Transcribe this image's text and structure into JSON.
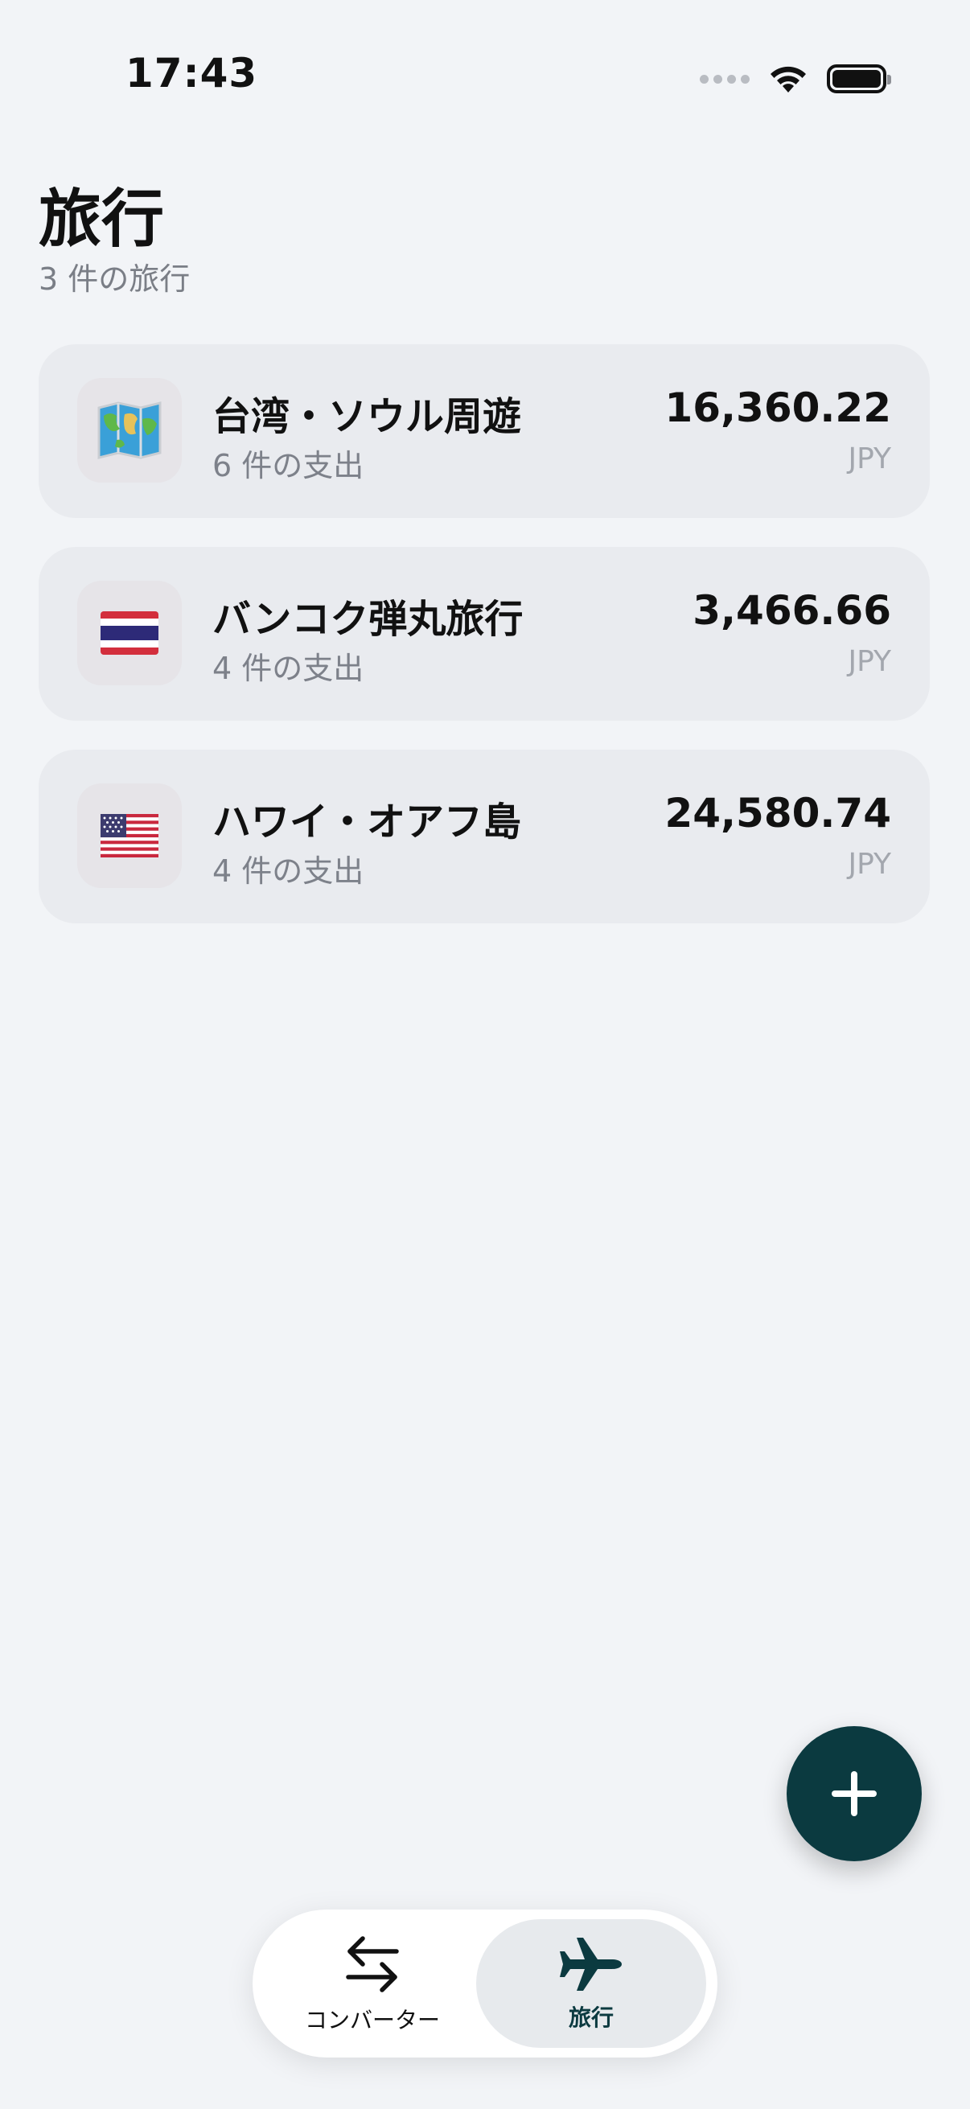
{
  "status_bar": {
    "time": "17:43"
  },
  "header": {
    "title": "旅行",
    "subtitle": "3 件の旅行"
  },
  "trips": [
    {
      "name": "台湾・ソウル周遊",
      "expense_count": "6 件の支出",
      "amount": "16,360.22",
      "currency": "JPY",
      "icon": "world-map-icon"
    },
    {
      "name": "バンコク弾丸旅行",
      "expense_count": "4 件の支出",
      "amount": "3,466.66",
      "currency": "JPY",
      "icon": "thailand-flag-icon"
    },
    {
      "name": "ハワイ・オアフ島",
      "expense_count": "4 件の支出",
      "amount": "24,580.74",
      "currency": "JPY",
      "icon": "usa-flag-icon"
    }
  ],
  "fab": {
    "icon": "plus-icon"
  },
  "tab_bar": {
    "tabs": [
      {
        "label": "コンバーター",
        "icon": "swap-arrows-icon",
        "selected": false
      },
      {
        "label": "旅行",
        "icon": "airplane-icon",
        "selected": true
      }
    ]
  },
  "colors": {
    "background": "#f2f4f7",
    "card": "#e9ebef",
    "accent": "#0b3a40",
    "secondary_text": "#7d818a"
  }
}
